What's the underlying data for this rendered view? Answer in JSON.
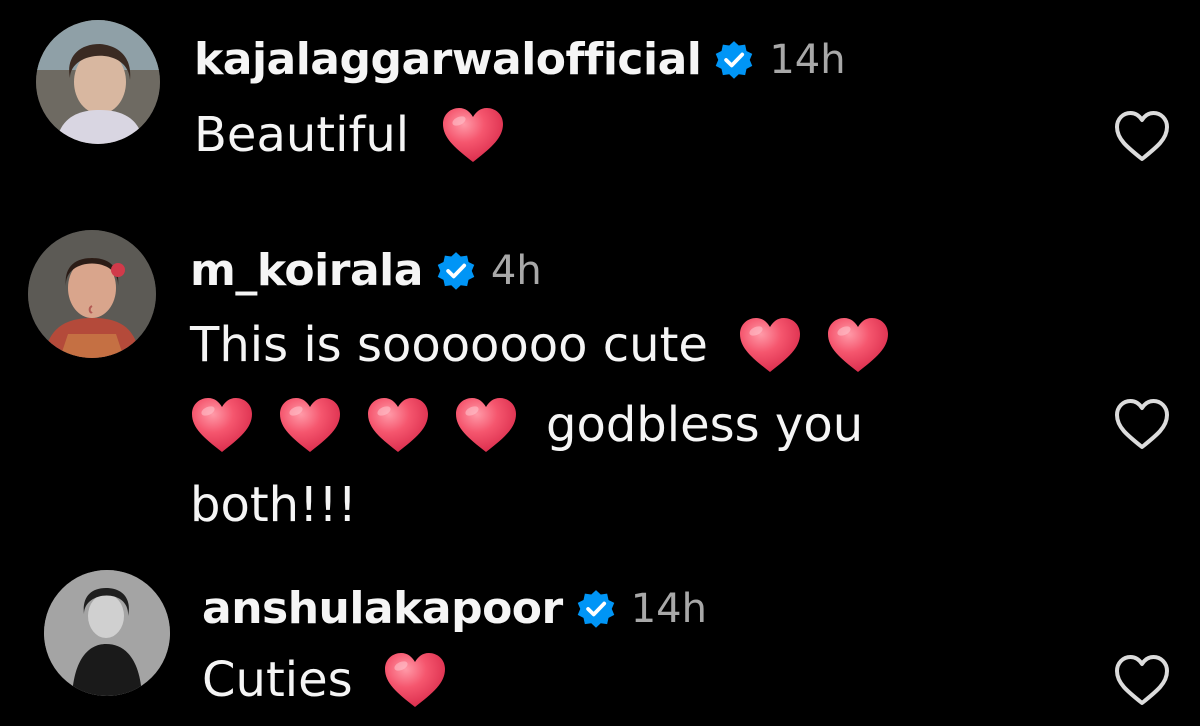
{
  "comments": [
    {
      "username": "kajalaggarwalofficial",
      "time": "14h",
      "lines": [
        "Beautiful"
      ],
      "avatar_color": "#cbb7a6"
    },
    {
      "username": "m_koirala",
      "time": "4h",
      "line1": "This is sooooooo cute",
      "line2": "godbless you",
      "line3": "both!!!",
      "avatar_color": "#b65540"
    },
    {
      "username": "anshulakapoor",
      "time": "14h",
      "lines": [
        "Cuties"
      ],
      "avatar_color": "#8a8a8a"
    }
  ],
  "icons": {
    "verified": "verified-badge-icon",
    "heart_emoji": "red-heart-emoji",
    "like": "heart-outline-icon"
  },
  "colors": {
    "background": "#000000",
    "verified": "#0095f6",
    "muted_text": "#a8a8a8",
    "heart_emoji": "#f0455d"
  }
}
